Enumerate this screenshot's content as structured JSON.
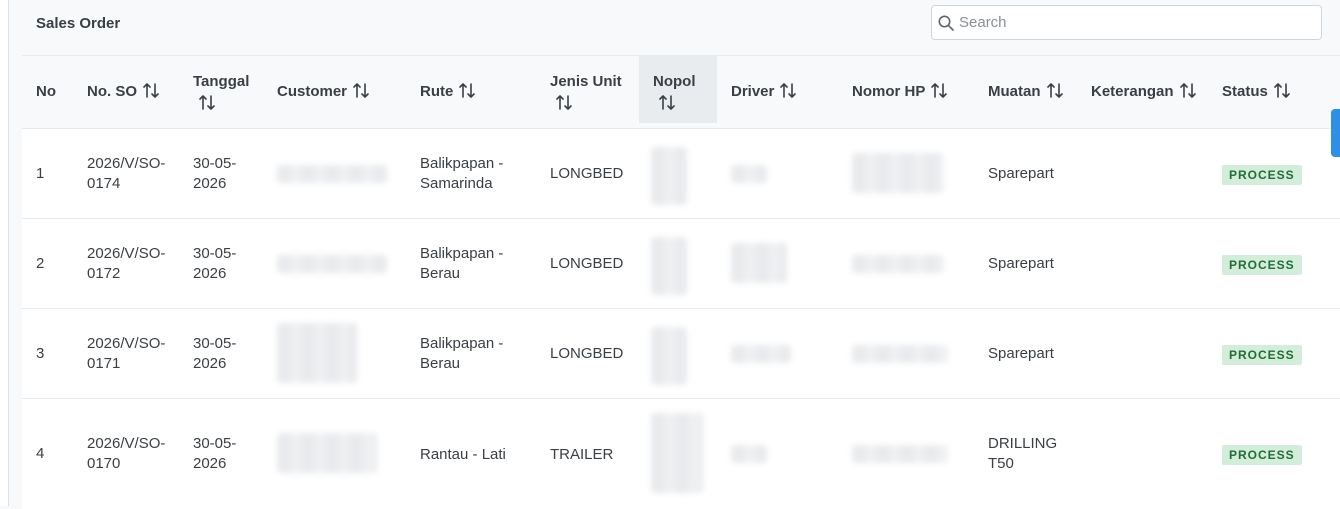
{
  "card": {
    "title": "Sales Order"
  },
  "search": {
    "placeholder": "Search",
    "value": "",
    "icon": "search-icon"
  },
  "table": {
    "headers": {
      "no": "No",
      "no_so": "No. SO",
      "tanggal": "Tanggal",
      "customer": "Customer",
      "rute": "Rute",
      "jenis_unit_1": "Jenis Unit",
      "nopol": "Nopol",
      "driver": "Driver",
      "nomor_hp": "Nomor HP",
      "muatan": "Muatan",
      "keterangan": "Keterangan",
      "status": "Status"
    },
    "rows": [
      {
        "no": "1",
        "so_1": "2026/V/SO-",
        "so_2": "0174",
        "tgl_1": "30-05-",
        "tgl_2": "2026",
        "rute_1": "Balikpapan -",
        "rute_2": "Samarinda",
        "unit": "LONGBED",
        "muatan_1": "Sparepart",
        "muatan_2": "",
        "status": "PROCESS"
      },
      {
        "no": "2",
        "so_1": "2026/V/SO-",
        "so_2": "0172",
        "tgl_1": "30-05-",
        "tgl_2": "2026",
        "rute_1": "Balikpapan -",
        "rute_2": "Berau",
        "unit": "LONGBED",
        "muatan_1": "Sparepart",
        "muatan_2": "",
        "status": "PROCESS"
      },
      {
        "no": "3",
        "so_1": "2026/V/SO-",
        "so_2": "0171",
        "tgl_1": "30-05-",
        "tgl_2": "2026",
        "rute_1": "Balikpapan -",
        "rute_2": "Berau",
        "unit": "LONGBED",
        "muatan_1": "Sparepart",
        "muatan_2": "",
        "status": "PROCESS"
      },
      {
        "no": "4",
        "so_1": "2026/V/SO-",
        "so_2": "0170",
        "tgl_1": "30-05-",
        "tgl_2": "2026",
        "rute_1": "Rantau - Lati",
        "rute_2": "",
        "unit": "TRAILER",
        "muatan_1": "DRILLING",
        "muatan_2": "T50",
        "status": "PROCESS"
      }
    ]
  },
  "colors": {
    "status_badge_bg": "#d4edda",
    "status_badge_text": "#1f6e34",
    "accent": "#2e8fe6"
  }
}
